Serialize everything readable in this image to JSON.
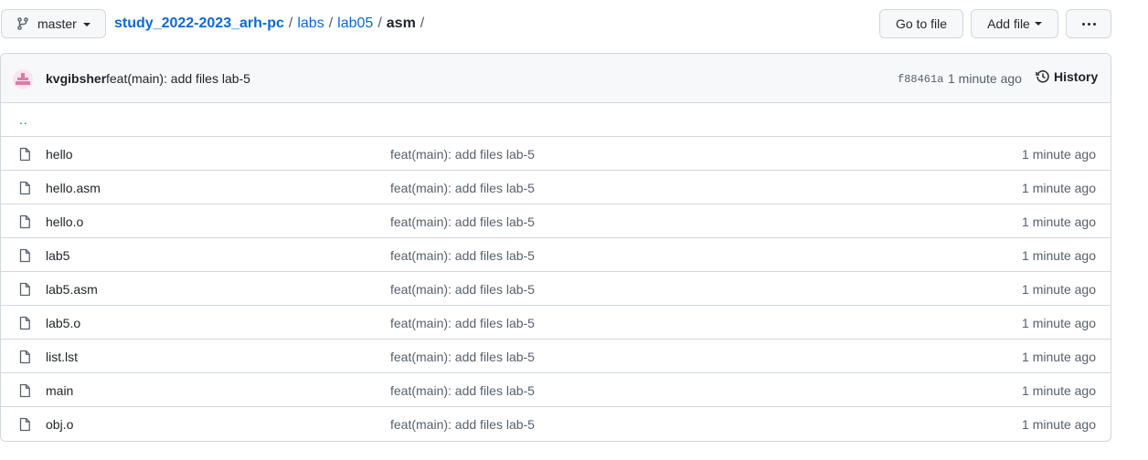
{
  "branch": {
    "name": "master",
    "icon": "git-branch-icon"
  },
  "breadcrumb": {
    "repo": "study_2022-2023_arh-pc",
    "path": [
      "labs",
      "lab05"
    ],
    "current": "asm",
    "separator": "/"
  },
  "actions": {
    "goto_label": "Go to file",
    "add_label": "Add file",
    "more_icon": "kebab-horizontal-icon"
  },
  "commit": {
    "author": "kvgibsher",
    "message": "feat(main): add files lab-5",
    "sha": "f88461a",
    "time": "1 minute ago",
    "history_label": "History"
  },
  "parent_link": "..",
  "files": [
    {
      "name": "hello",
      "message": "feat(main): add files lab-5",
      "time": "1 minute ago"
    },
    {
      "name": "hello.asm",
      "message": "feat(main): add files lab-5",
      "time": "1 minute ago"
    },
    {
      "name": "hello.o",
      "message": "feat(main): add files lab-5",
      "time": "1 minute ago"
    },
    {
      "name": "lab5",
      "message": "feat(main): add files lab-5",
      "time": "1 minute ago"
    },
    {
      "name": "lab5.asm",
      "message": "feat(main): add files lab-5",
      "time": "1 minute ago"
    },
    {
      "name": "lab5.o",
      "message": "feat(main): add files lab-5",
      "time": "1 minute ago"
    },
    {
      "name": "list.lst",
      "message": "feat(main): add files lab-5",
      "time": "1 minute ago"
    },
    {
      "name": "main",
      "message": "feat(main): add files lab-5",
      "time": "1 minute ago"
    },
    {
      "name": "obj.o",
      "message": "feat(main): add files lab-5",
      "time": "1 minute ago"
    }
  ],
  "colors": {
    "link": "#0969da",
    "muted": "#57606a",
    "border": "#d0d7de",
    "header_bg": "#f6f8fa"
  }
}
